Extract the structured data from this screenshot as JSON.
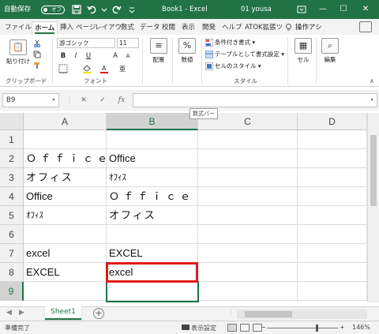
{
  "titlebar": {
    "autosave_label": "自動保存",
    "autosave_state": "オフ",
    "doc_title": "Book1  -  Excel",
    "user": "01 yousa",
    "min": "—",
    "restore": "☐",
    "close": "✕"
  },
  "tabs": [
    "ファイル",
    "ホーム",
    "挿入",
    "ページ",
    "レイアウ",
    "数式",
    "データ",
    "校閲",
    "表示",
    "開発",
    "ヘルプ",
    "ATOK拡張ツ"
  ],
  "tell_me": "操作アシ",
  "ribbon": {
    "clipboard": {
      "paste": "貼り付け",
      "label": "クリップボード"
    },
    "font": {
      "name": "游ゴシック",
      "size": "11",
      "label": "フォント",
      "bold": "B",
      "italic": "I",
      "underline": "U"
    },
    "alignment": {
      "label": "配置"
    },
    "number": {
      "label": "数値",
      "icon": "%"
    },
    "styles": {
      "conditional": "条件付き書式 ▾",
      "table": "テーブルとして書式設定 ▾",
      "cell_styles": "セルのスタイル ▾",
      "label": "スタイル"
    },
    "cells": {
      "label": "セル"
    },
    "editing": {
      "label": "編集"
    }
  },
  "formula_bar": {
    "name_box": "B9",
    "cancel": "✕",
    "enter": "✓",
    "fx": "fx",
    "tooltip": "数式バー"
  },
  "columns": [
    "A",
    "B",
    "C",
    "D"
  ],
  "rows": [
    {
      "num": "1",
      "a": "",
      "b": ""
    },
    {
      "num": "2",
      "a": "Ｏｆｆｉｃｅ",
      "b": "Office"
    },
    {
      "num": "3",
      "a": "オフィス",
      "b": "ｵﾌｨｽ"
    },
    {
      "num": "4",
      "a": "Office",
      "b": "Ｏｆｆｉｃｅ"
    },
    {
      "num": "5",
      "a": "ｵﾌｨｽ",
      "b": "オフィス"
    },
    {
      "num": "6",
      "a": "",
      "b": ""
    },
    {
      "num": "7",
      "a": "excel",
      "b": "EXCEL"
    },
    {
      "num": "8",
      "a": "EXCEL",
      "b": "excel"
    },
    {
      "num": "9",
      "a": "",
      "b": ""
    }
  ],
  "sheet_tab": "Sheet1",
  "statusbar": {
    "status": "準備完了",
    "display_settings": "表示設定",
    "zoom": "146%",
    "zoom_minus": "−",
    "zoom_plus": "+"
  },
  "colors": {
    "accent": "#217346",
    "highlight": "#e01a1a"
  }
}
